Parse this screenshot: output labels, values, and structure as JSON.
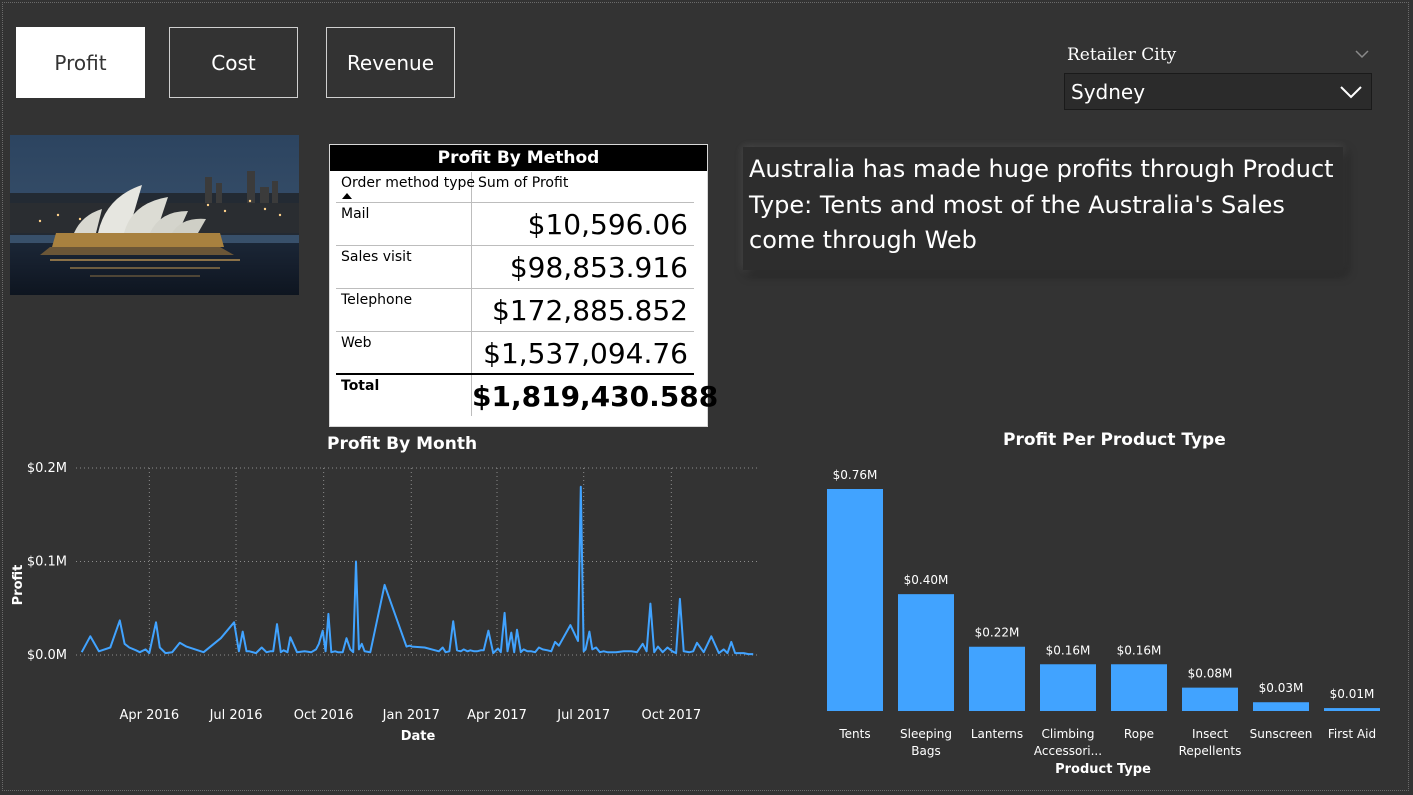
{
  "tabs": [
    {
      "label": "Profit",
      "active": true
    },
    {
      "label": "Cost",
      "active": false
    },
    {
      "label": "Revenue",
      "active": false
    }
  ],
  "slicer": {
    "title": "Retailer City",
    "value": "Sydney"
  },
  "photo": {
    "icon": "sydney-opera-house-night-image"
  },
  "profit_table": {
    "title": "Profit By Method",
    "columns": [
      "Order method type",
      "Sum of Profit"
    ],
    "rows": [
      {
        "method": "Mail",
        "profit": "$10,596.06"
      },
      {
        "method": "Sales visit",
        "profit": "$98,853.916"
      },
      {
        "method": "Telephone",
        "profit": "$172,885.852"
      },
      {
        "method": "Web",
        "profit": "$1,537,094.76"
      }
    ],
    "total": {
      "label": "Total",
      "profit": "$1,819,430.588"
    }
  },
  "insight": {
    "text": "Australia has made huge profits through Product Type: Tents and most of the Australia's Sales come through Web"
  },
  "colors": {
    "background": "#333333",
    "accent": "#41a3ff"
  },
  "chart_data": [
    {
      "type": "line",
      "title": "Profit By Month",
      "xlabel": "Date",
      "ylabel": "Profit",
      "ytick_labels": [
        "$0.0M",
        "$0.1M",
        "$0.2M"
      ],
      "ylim": [
        0,
        0.2
      ],
      "xtick_labels": [
        "Apr 2016",
        "Jul 2016",
        "Oct 2016",
        "Jan 2017",
        "Apr 2017",
        "Jul 2017",
        "Oct 2017"
      ],
      "xlim": [
        "2016-01-15",
        "2017-12-31"
      ],
      "grid": true,
      "series": [
        {
          "x": [
            "2016-01-21",
            "2016-01-30",
            "2016-02-08",
            "2016-02-20",
            "2016-03-01",
            "2016-03-06",
            "2016-03-11",
            "2016-03-18",
            "2016-03-22",
            "2016-03-28",
            "2016-04-01",
            "2016-04-08",
            "2016-04-12",
            "2016-04-18",
            "2016-04-25",
            "2016-05-03",
            "2016-05-10",
            "2016-05-28",
            "2016-06-15",
            "2016-06-29",
            "2016-07-04",
            "2016-07-08",
            "2016-07-12",
            "2016-07-15",
            "2016-07-22",
            "2016-07-28",
            "2016-08-02",
            "2016-08-06",
            "2016-08-09",
            "2016-08-13",
            "2016-08-17",
            "2016-08-20",
            "2016-08-24",
            "2016-08-27",
            "2016-09-03",
            "2016-09-11",
            "2016-09-18",
            "2016-09-23",
            "2016-09-26",
            "2016-09-30",
            "2016-10-03",
            "2016-10-06",
            "2016-10-09",
            "2016-10-13",
            "2016-10-16",
            "2016-10-21",
            "2016-10-25",
            "2016-10-29",
            "2016-11-01",
            "2016-11-04",
            "2016-11-07",
            "2016-11-10",
            "2016-11-13",
            "2016-11-19",
            "2016-12-04",
            "2016-12-27",
            "2016-12-30",
            "2017-01-02",
            "2017-01-15",
            "2017-01-30",
            "2017-02-03",
            "2017-02-06",
            "2017-02-10",
            "2017-02-14",
            "2017-02-18",
            "2017-02-22",
            "2017-02-25",
            "2017-03-01",
            "2017-03-04",
            "2017-03-08",
            "2017-03-11",
            "2017-03-15",
            "2017-03-18",
            "2017-03-23",
            "2017-03-28",
            "2017-04-02",
            "2017-04-05",
            "2017-04-09",
            "2017-04-12",
            "2017-04-16",
            "2017-04-19",
            "2017-04-22",
            "2017-04-26",
            "2017-04-29",
            "2017-05-03",
            "2017-05-07",
            "2017-05-11",
            "2017-05-15",
            "2017-05-19",
            "2017-05-24",
            "2017-05-28",
            "2017-06-01",
            "2017-06-05",
            "2017-06-17",
            "2017-06-25",
            "2017-06-28",
            "2017-07-01",
            "2017-07-03",
            "2017-07-07",
            "2017-07-10",
            "2017-07-14",
            "2017-07-18",
            "2017-07-22",
            "2017-07-26",
            "2017-07-30",
            "2017-08-04",
            "2017-08-12",
            "2017-08-20",
            "2017-08-26",
            "2017-09-01",
            "2017-09-05",
            "2017-09-09",
            "2017-09-13",
            "2017-09-17",
            "2017-09-22",
            "2017-09-27",
            "2017-10-02",
            "2017-10-06",
            "2017-10-10",
            "2017-10-14",
            "2017-10-20",
            "2017-10-24",
            "2017-10-28",
            "2017-11-04",
            "2017-11-12",
            "2017-11-20",
            "2017-11-25",
            "2017-11-29",
            "2017-12-03",
            "2017-12-07",
            "2017-12-12",
            "2017-12-16",
            "2017-12-21",
            "2017-12-26"
          ],
          "values": [
            0.003,
            0.02,
            0.004,
            0.008,
            0.037,
            0.012,
            0.008,
            0.005,
            0.003,
            0.006,
            0.002,
            0.035,
            0.008,
            0.002,
            0.003,
            0.013,
            0.009,
            0.003,
            0.018,
            0.035,
            0.004,
            0.025,
            0.004,
            0.004,
            0.002,
            0.008,
            0.003,
            0.004,
            0.004,
            0.033,
            0.003,
            0.005,
            0.003,
            0.019,
            0.003,
            0.004,
            0.003,
            0.006,
            0.012,
            0.026,
            0.004,
            0.044,
            0.003,
            0.004,
            0.003,
            0.003,
            0.018,
            0.006,
            0.003,
            0.1,
            0.006,
            0.012,
            0.004,
            0.003,
            0.075,
            0.009,
            0.01,
            0.009,
            0.008,
            0.004,
            0.008,
            0.003,
            0.004,
            0.036,
            0.005,
            0.004,
            0.006,
            0.004,
            0.005,
            0.004,
            0.004,
            0.005,
            0.005,
            0.026,
            0.002,
            0.007,
            0.003,
            0.045,
            0.004,
            0.024,
            0.003,
            0.027,
            0.003,
            0.006,
            0.004,
            0.004,
            0.003,
            0.008,
            0.006,
            0.005,
            0.004,
            0.014,
            0.01,
            0.032,
            0.015,
            0.18,
            0.004,
            0.006,
            0.025,
            0.006,
            0.008,
            0.003,
            0.004,
            0.003,
            0.003,
            0.003,
            0.004,
            0.004,
            0.003,
            0.012,
            0.004,
            0.055,
            0.003,
            0.009,
            0.003,
            0.008,
            0.004,
            0.002,
            0.06,
            0.004,
            0.003,
            0.004,
            0.013,
            0.003,
            0.02,
            0.002,
            0.006,
            0.002,
            0.014,
            0.002,
            0.002,
            0.002,
            0.001,
            0.001
          ]
        }
      ]
    },
    {
      "type": "bar",
      "title": "Profit Per Product Type",
      "xlabel": "Product Type",
      "ylabel": "",
      "categories": [
        "Tents",
        "Sleeping Bags",
        "Lanterns",
        "Climbing Accessori...",
        "Rope",
        "Insect Repellents",
        "Sunscreen",
        "First Aid"
      ],
      "category_lines": [
        [
          "Tents"
        ],
        [
          "Sleeping",
          "Bags"
        ],
        [
          "Lanterns"
        ],
        [
          "Climbing",
          "Accessori..."
        ],
        [
          "Rope"
        ],
        [
          "Insect",
          "Repellents"
        ],
        [
          "Sunscreen"
        ],
        [
          "First Aid"
        ]
      ],
      "values": [
        0.76,
        0.4,
        0.22,
        0.16,
        0.16,
        0.08,
        0.03,
        0.01
      ],
      "data_labels": [
        "$0.76M",
        "$0.40M",
        "$0.22M",
        "$0.16M",
        "$0.16M",
        "$0.08M",
        "$0.03M",
        "$0.01M"
      ],
      "ylim": [
        0,
        0.76
      ],
      "grid": false
    }
  ]
}
